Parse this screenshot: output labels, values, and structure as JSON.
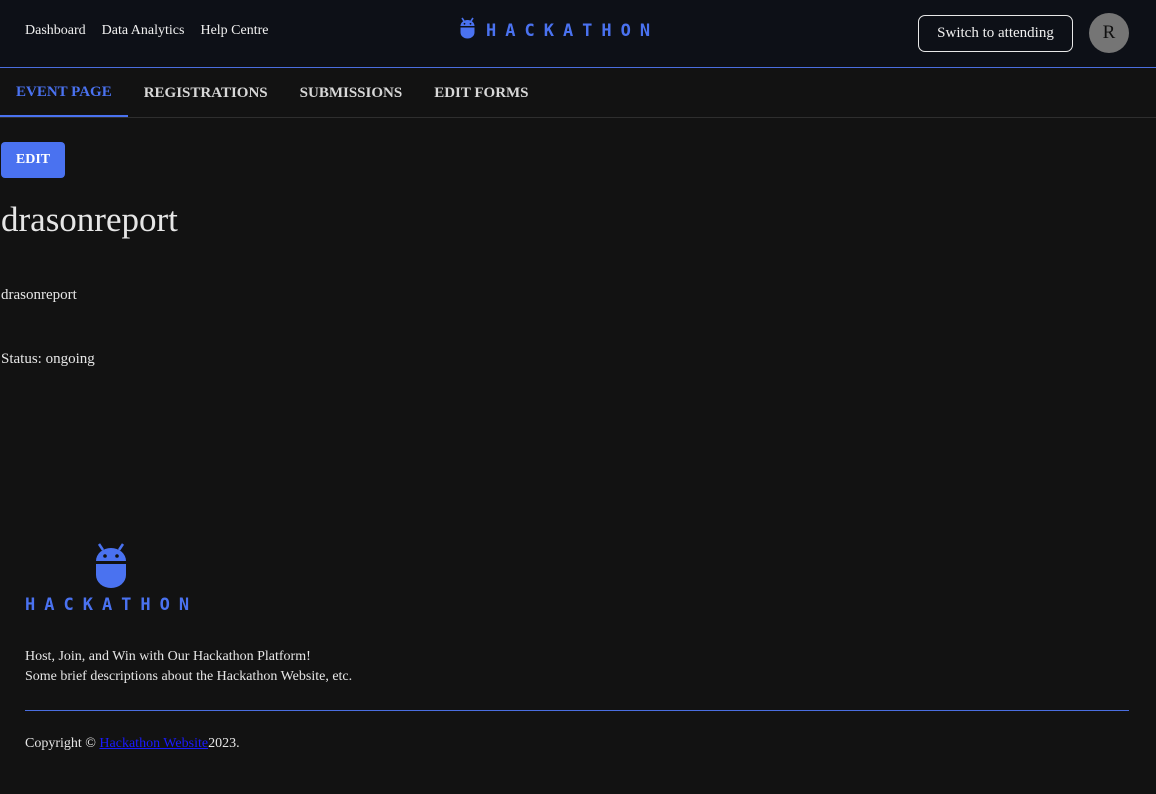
{
  "topnav": {
    "items": [
      "Dashboard",
      "Data Analytics",
      "Help Centre"
    ]
  },
  "brand": {
    "name": "HACKATHON",
    "icon": "android-robot-icon",
    "color": "#4a72f0"
  },
  "header": {
    "switch_label": "Switch to attending",
    "avatar_initial": "R"
  },
  "tabs": [
    {
      "label": "EVENT PAGE",
      "active": true
    },
    {
      "label": "REGISTRATIONS",
      "active": false
    },
    {
      "label": "SUBMISSIONS",
      "active": false
    },
    {
      "label": "EDIT FORMS",
      "active": false
    }
  ],
  "event": {
    "edit_label": "EDIT",
    "title": "drasonreport",
    "description": "drasonreport",
    "status": "Status: ongoing"
  },
  "footer": {
    "brand": "HACKATHON",
    "tagline_1": "Host, Join, and Win with Our Hackathon Platform!",
    "tagline_2": "Some brief descriptions about the Hackathon Website, etc.",
    "copyright_prefix": "Copyright © ",
    "copyright_link": "Hackathon Website",
    "copyright_suffix": "2023."
  }
}
